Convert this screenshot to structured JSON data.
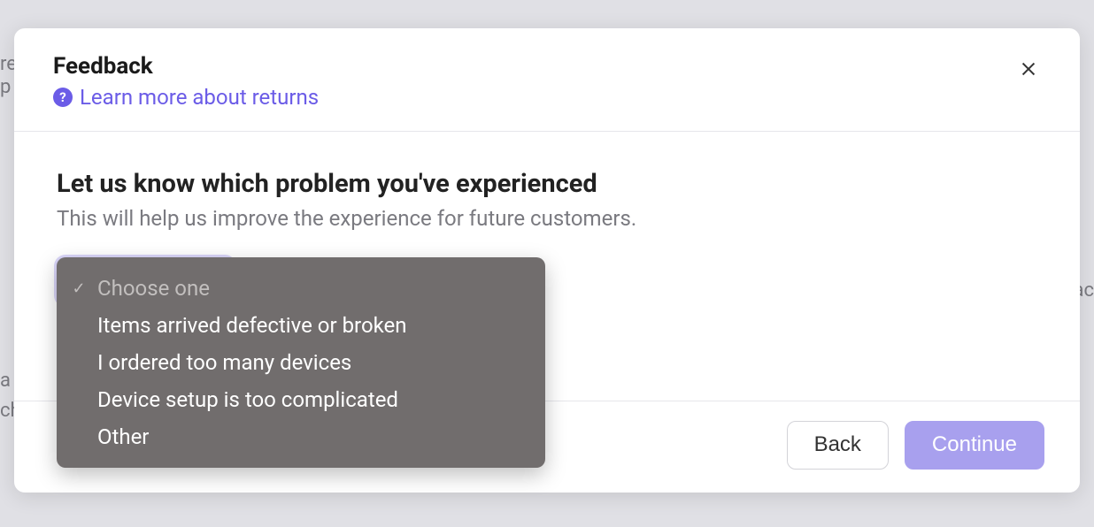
{
  "modal": {
    "title": "Feedback",
    "help_link_text": "Learn more about returns",
    "question": "Let us know which problem you've experienced",
    "subtext": "This will help us improve the experience for future customers.",
    "select": {
      "placeholder": "Choose one",
      "options": [
        "Items arrived defective or broken",
        "I ordered too many devices",
        "Device setup is too complicated",
        "Other"
      ]
    },
    "footer": {
      "back_label": "Back",
      "continue_label": "Continue"
    }
  },
  "background_fragments": {
    "top_left_1": "re",
    "top_left_2": "p",
    "right_mid": "ac",
    "left_mid_1": "a",
    "left_mid_2": "ch"
  }
}
